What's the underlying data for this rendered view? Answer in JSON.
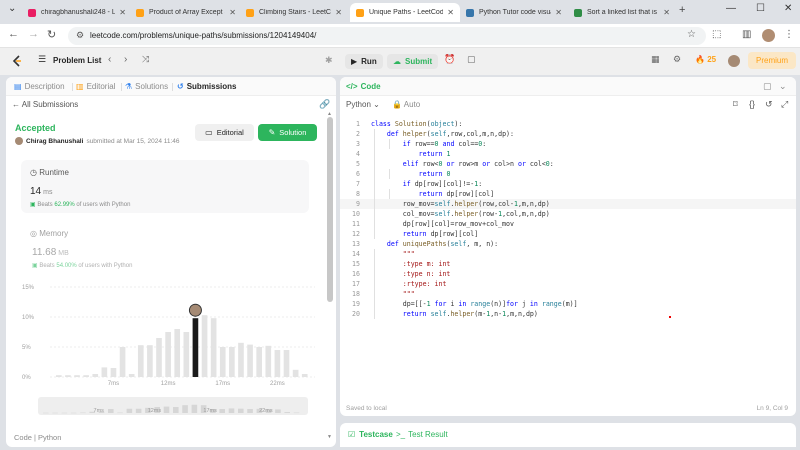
{
  "browser": {
    "tabs": [
      {
        "title": "chiragbhanushali248 - Le",
        "color": "#e91e63"
      },
      {
        "title": "Product of Array Except S",
        "color": "#ffa116"
      },
      {
        "title": "Climbing Stairs - LeetCo",
        "color": "#ffa116"
      },
      {
        "title": "Unique Paths - LeetCode",
        "color": "#ffa116"
      },
      {
        "title": "Python Tutor code visual",
        "color": "#3776ab"
      },
      {
        "title": "Sort a linked list that is s",
        "color": "#2f8d46"
      }
    ],
    "new_tab": "+",
    "window_controls": [
      "⌄",
      "—",
      "☐",
      "✕"
    ],
    "url": "leetcode.com/problems/unique-paths/submissions/1204149404/"
  },
  "lc_nav": {
    "problem_list": "Problem List",
    "run": "Run",
    "submit": "Submit",
    "streak": "25",
    "premium": "Premium"
  },
  "left": {
    "tabs": [
      "Description",
      "Editorial",
      "Solutions",
      "Submissions"
    ],
    "all_submissions": "All Submissions",
    "status": "Accepted",
    "author": "Chirag Bhanushali",
    "submitted": "submitted at Mar 15, 2024 11:46",
    "editorial_btn": "Editorial",
    "solution_btn": "Solution",
    "runtime_label": "Runtime",
    "runtime_value": "14",
    "runtime_unit": "ms",
    "runtime_beats_prefix": "Beats",
    "runtime_beats": "62.99%",
    "runtime_beats_suffix": "of users with Python",
    "memory_label": "Memory",
    "memory_value": "11.68",
    "memory_unit": "MB",
    "memory_beats_prefix": "Beats",
    "memory_beats": "54.00%",
    "memory_beats_suffix": "of users with Python",
    "code_footer": "Code | Python"
  },
  "chart_data": {
    "type": "bar",
    "yticks": [
      "15%",
      "10%",
      "5%",
      "0%"
    ],
    "ylim": [
      0,
      15
    ],
    "xticks": [
      "7ms",
      "12ms",
      "17ms",
      "22ms"
    ],
    "values": [
      0.3,
      0.3,
      0.3,
      0.3,
      0.5,
      1.6,
      1.5,
      5,
      0.5,
      5.3,
      5.3,
      6.5,
      7.5,
      8,
      7.5,
      9.8,
      10.3,
      9.8,
      5,
      5,
      5.7,
      5.4,
      5,
      5.2,
      4.5,
      4.5,
      1.2,
      0.5
    ],
    "highlight_index": 15,
    "minimap_ticks": [
      "7ms",
      "12ms",
      "17ms",
      "22ms"
    ]
  },
  "right": {
    "header": "Code",
    "language": "Python",
    "auto": "Auto",
    "saved": "Saved to local",
    "cursor": "Ln 9, Col 9",
    "code_lines": [
      "class Solution(object):",
      "    def helper(self,row,col,m,n,dp):",
      "        if row==0 and col==0:",
      "            return 1",
      "        elif row<0 or row>m or col>n or col<0:",
      "            return 0",
      "        if dp[row][col]!=-1:",
      "            return dp[row][col]",
      "        row_mov=self.helper(row,col-1,m,n,dp)",
      "        col_mov=self.helper(row-1,col,m,n,dp)",
      "        dp[row][col]=row_mov+col_mov",
      "        return dp[row][col]",
      "    def uniquePaths(self, m, n):",
      "        \"\"\"",
      "        :type m: int",
      "        :type n: int",
      "        :rtype: int",
      "        \"\"\"",
      "        dp=[[-1 for i in range(n)]for j in range(m)]",
      "        return self.helper(m-1,n-1,m,n,dp)"
    ]
  },
  "bottom": {
    "testcase": "Testcase",
    "test_result": "Test Result"
  }
}
